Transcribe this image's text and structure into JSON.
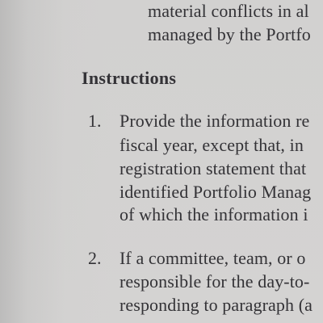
{
  "top_paragraph": {
    "lines": [
      "material conflicts in al",
      "managed by the Portfo"
    ]
  },
  "heading": "Instructions",
  "items": [
    {
      "number": "1.",
      "lines": [
        "Provide the information re",
        "fiscal year, except that, in",
        "registration statement that",
        "identified Portfolio Manag",
        "of which the information i"
      ]
    },
    {
      "number": "2.",
      "lines": [
        "If a committee, team, or o",
        "responsible for the day-to-",
        "responding to paragraph (a"
      ]
    }
  ]
}
